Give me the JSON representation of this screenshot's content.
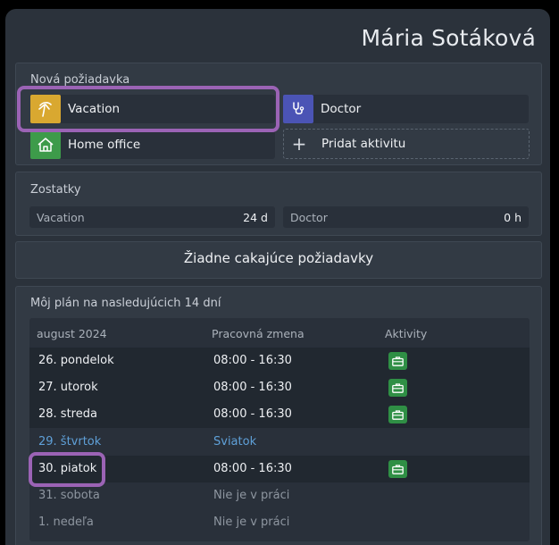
{
  "header": {
    "user_name": "Mária Sotáková"
  },
  "new_request": {
    "title": "Nová požiadavka",
    "activities": [
      {
        "label": "Vacation",
        "icon": "palm-tree-icon",
        "color": "#d9a830"
      },
      {
        "label": "Doctor",
        "icon": "stethoscope-icon",
        "color": "#4b54b5"
      },
      {
        "label": "Home office",
        "icon": "house-icon",
        "color": "#3d9b4a"
      }
    ],
    "add_label": "Pridat aktivitu"
  },
  "balances": {
    "title": "Zostatky",
    "items": [
      {
        "label": "Vacation",
        "value": "24 d"
      },
      {
        "label": "Doctor",
        "value": "0 h"
      }
    ]
  },
  "pending": {
    "text": "Žiadne cakajúce požiadavky"
  },
  "plan": {
    "title": "Môj plán na nasledujúcich 14 dní",
    "columns": [
      "august 2024",
      "Pracovná zmena",
      "Aktivity"
    ],
    "rows": [
      {
        "day": "26. pondelok",
        "shift": "08:00 - 16:30",
        "activity": "briefcase-icon",
        "type": "work"
      },
      {
        "day": "27. utorok",
        "shift": "08:00 - 16:30",
        "activity": "briefcase-icon",
        "type": "work"
      },
      {
        "day": "28. streda",
        "shift": "08:00 - 16:30",
        "activity": "briefcase-icon",
        "type": "work"
      },
      {
        "day": "29. štvrtok",
        "shift": "Sviatok",
        "activity": "",
        "type": "holiday"
      },
      {
        "day": "30. piatok",
        "shift": "08:00 - 16:30",
        "activity": "briefcase-icon",
        "type": "work"
      },
      {
        "day": "31. sobota",
        "shift": "Nie je v práci",
        "activity": "",
        "type": "off"
      },
      {
        "day": "1. nedeľa",
        "shift": "Nie je v práci",
        "activity": "",
        "type": "off"
      }
    ]
  },
  "colors": {
    "accent_highlight": "#9b63b5",
    "activity_green": "#2f8f45",
    "holiday_blue": "#5fa0d8"
  }
}
